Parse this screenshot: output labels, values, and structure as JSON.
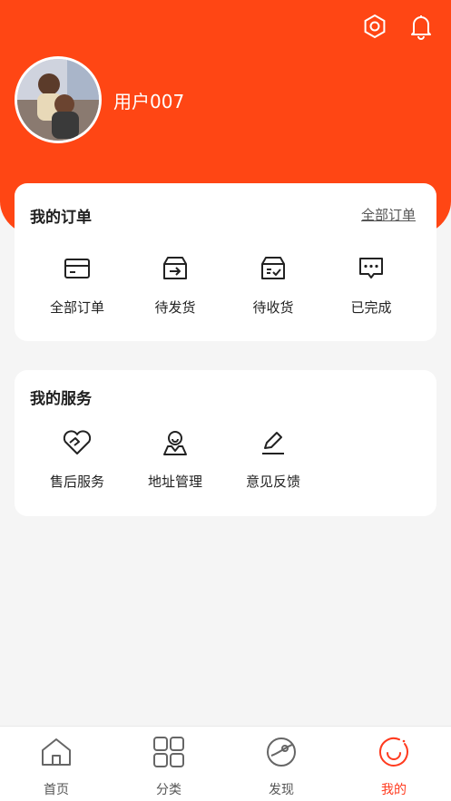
{
  "header": {
    "username": "用户007",
    "settings_icon": "settings-hexagon-icon",
    "bell_icon": "bell-icon"
  },
  "orders": {
    "title": "我的订单",
    "all_link": "全部订单",
    "items": [
      {
        "label": "全部订单",
        "icon": "card-icon"
      },
      {
        "label": "待发货",
        "icon": "box-arrow-icon"
      },
      {
        "label": "待收货",
        "icon": "box-check-icon"
      },
      {
        "label": "已完成",
        "icon": "chat-dots-icon"
      }
    ]
  },
  "services": {
    "title": "我的服务",
    "items": [
      {
        "label": "售后服务",
        "icon": "heart-handshake-icon"
      },
      {
        "label": "地址管理",
        "icon": "location-user-icon"
      },
      {
        "label": "意见反馈",
        "icon": "pen-icon"
      }
    ]
  },
  "tabbar": {
    "items": [
      {
        "label": "首页",
        "icon": "home-icon"
      },
      {
        "label": "分类",
        "icon": "grid-icon"
      },
      {
        "label": "发现",
        "icon": "planet-icon"
      },
      {
        "label": "我的",
        "icon": "smile-icon"
      }
    ],
    "active_color": "#ff3b1f"
  },
  "colors": {
    "brand": "#ff4614",
    "background": "#f5f5f5"
  }
}
